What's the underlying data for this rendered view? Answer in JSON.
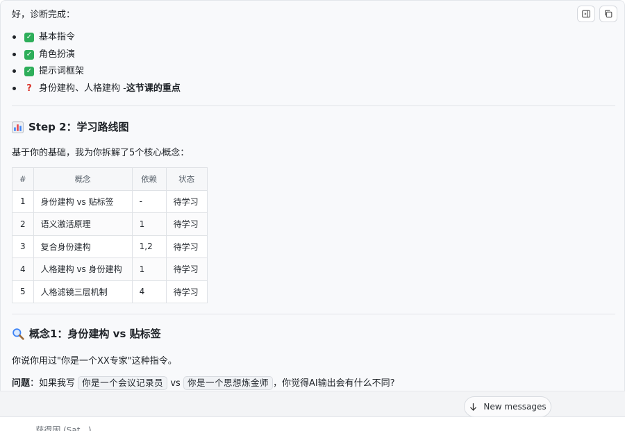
{
  "toolbar": {
    "sidebar_icon": "sidebar-toggle-icon",
    "copy_icon": "copy-icon"
  },
  "message": {
    "intro": "好，诊断完成：",
    "checklist": [
      {
        "icon": "check-box-icon",
        "label": "基本指令"
      },
      {
        "icon": "check-box-icon",
        "label": "角色扮演"
      },
      {
        "icon": "check-box-icon",
        "label": "提示词框架"
      }
    ],
    "focus_item": {
      "icon": "question-mark-icon",
      "label": "身份建构、人格建构 - ",
      "emphasis": "这节课的重点"
    },
    "step2": {
      "icon": "bar-chart-icon",
      "title": "Step 2：学习路线图",
      "desc": "基于你的基础，我为你拆解了5个核心概念：",
      "table": {
        "headers": [
          "#",
          "概念",
          "依赖",
          "状态"
        ],
        "rows": [
          [
            "1",
            "身份建构 vs 贴标签",
            "-",
            "待学习"
          ],
          [
            "2",
            "语义激活原理",
            "1",
            "待学习"
          ],
          [
            "3",
            "复合身份建构",
            "1,2",
            "待学习"
          ],
          [
            "4",
            "人格建构 vs 身份建构",
            "1",
            "待学习"
          ],
          [
            "5",
            "人格滤镜三层机制",
            "4",
            "待学习"
          ]
        ]
      }
    },
    "concept1": {
      "icon": "magnifier-icon",
      "title": "概念1：身份建构 vs 贴标签",
      "para": "你说你用过\"你是一个XX专家\"这种指令。",
      "question_label": "问题",
      "q_prefix": "：如果我写",
      "code_a": "你是一个会议记录员",
      "vs": "vs",
      "code_b": "你是一个思想炼金师",
      "q_suffix": "，你觉得AI输出会有什么不同?"
    }
  },
  "new_messages": {
    "label": "New messages",
    "icon": "arrow-down-icon"
  },
  "bottom": {
    "text": "... 获得因 (Sat...) ... ..."
  }
}
